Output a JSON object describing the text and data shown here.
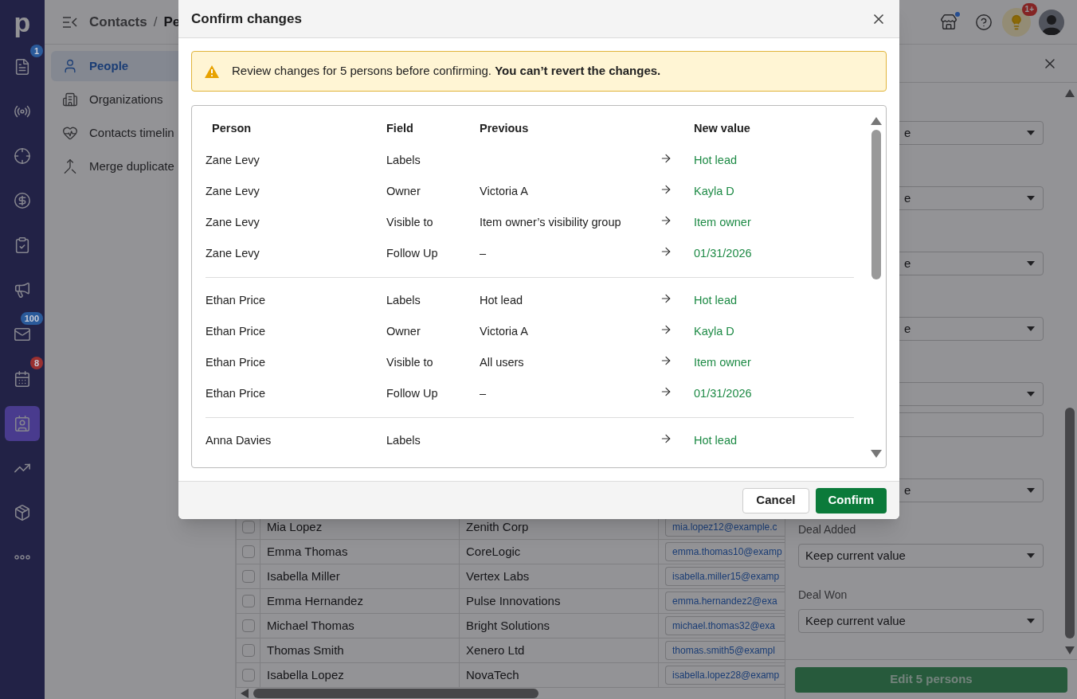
{
  "rail": {
    "logo": "p",
    "items": [
      {
        "selected": false,
        "badge": {
          "text": "1",
          "color": "#2a5a9a"
        }
      },
      {
        "selected": false
      },
      {
        "selected": false
      },
      {
        "selected": false
      },
      {
        "selected": false
      },
      {
        "selected": false
      },
      {
        "selected": false,
        "badge": {
          "text": "100",
          "color": "#2a5a9a"
        }
      },
      {
        "selected": false,
        "badge": {
          "text": "8",
          "color": "#9a3030"
        }
      },
      {
        "selected": true
      },
      {
        "selected": false
      },
      {
        "selected": false
      },
      {
        "selected": false
      }
    ]
  },
  "header": {
    "breadcrumb_root": "Contacts",
    "breadcrumb_separator": "/",
    "breadcrumb_current": "Pe",
    "tips_badge": "1+"
  },
  "subnav": [
    {
      "label": "People",
      "selected": true
    },
    {
      "label": "Organizations",
      "selected": false
    },
    {
      "label": "Contacts timelin",
      "selected": false
    },
    {
      "label": "Merge duplicate",
      "selected": false
    }
  ],
  "table": {
    "rows": [
      {
        "checked": false,
        "name": "Mia Lopez",
        "organization": "Zenith Corp",
        "email": "mia.lopez12@example.c"
      },
      {
        "checked": false,
        "name": "Emma Thomas",
        "organization": "CoreLogic",
        "email": "emma.thomas10@examp"
      },
      {
        "checked": false,
        "name": "Isabella Miller",
        "organization": "Vertex Labs",
        "email": "isabella.miller15@examp"
      },
      {
        "checked": false,
        "name": "Emma Hernandez",
        "organization": "Pulse Innovations",
        "email": "emma.hernandez2@exa"
      },
      {
        "checked": false,
        "name": "Michael Thomas",
        "organization": "Bright Solutions",
        "email": "michael.thomas32@exa"
      },
      {
        "checked": false,
        "name": "Thomas Smith",
        "organization": "Xenero Ltd",
        "email": "thomas.smith5@exampl"
      },
      {
        "checked": false,
        "name": "Isabella Lopez",
        "organization": "NovaTech",
        "email": "isabella.lopez28@examp"
      }
    ]
  },
  "edit_panel": {
    "fields": [
      {
        "kind": "select",
        "value": "e"
      },
      {
        "kind": "select",
        "value": "e"
      },
      {
        "kind": "select",
        "value": "e"
      },
      {
        "kind": "select",
        "value": "e"
      },
      {
        "kind": "select"
      },
      {
        "kind": "input"
      },
      {
        "kind": "select",
        "value": "e"
      },
      {
        "kind": "select",
        "label": "Deal Added",
        "value": "Keep current value"
      },
      {
        "kind": "select",
        "label": "Deal Won",
        "value": "Keep current value"
      }
    ],
    "submit": "Edit 5 persons"
  },
  "modal": {
    "title": "Confirm changes",
    "alert": "Review changes for 5 persons before confirming. **You can’t revert the changes.**",
    "columns": [
      "Person",
      "Field",
      "Previous",
      "New value"
    ],
    "groups": [
      {
        "rows": [
          {
            "person": "Zane Levy",
            "field": "Labels",
            "previous": "",
            "new_value": "Hot lead"
          },
          {
            "person": "Zane Levy",
            "field": "Owner",
            "previous": "Victoria A",
            "new_value": "Kayla D"
          },
          {
            "person": "Zane Levy",
            "field": "Visible to",
            "previous": "Item owner’s visibility group",
            "new_value": "Item owner"
          },
          {
            "person": "Zane Levy",
            "field": "Follow Up",
            "previous": "–",
            "new_value": "01/31/2026"
          }
        ]
      },
      {
        "rows": [
          {
            "person": "Ethan Price",
            "field": "Labels",
            "previous": "Hot lead",
            "new_value": "Hot lead"
          },
          {
            "person": "Ethan Price",
            "field": "Owner",
            "previous": "Victoria A",
            "new_value": "Kayla D"
          },
          {
            "person": "Ethan Price",
            "field": "Visible to",
            "previous": "All users",
            "new_value": "Item owner"
          },
          {
            "person": "Ethan Price",
            "field": "Follow Up",
            "previous": "–",
            "new_value": "01/31/2026"
          }
        ]
      },
      {
        "rows": [
          {
            "person": "Anna Davies",
            "field": "Labels",
            "previous": "",
            "new_value": "Hot lead"
          }
        ]
      }
    ],
    "buttons": {
      "cancel": "Cancel",
      "confirm": "Confirm"
    }
  }
}
